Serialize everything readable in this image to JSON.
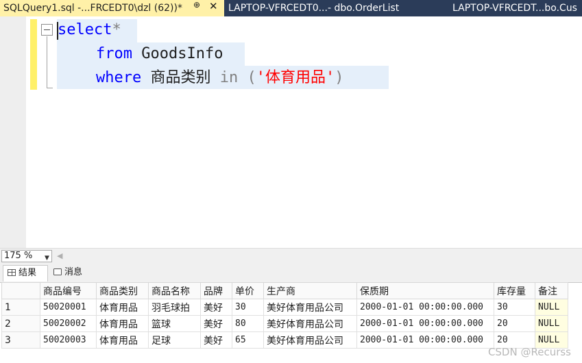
{
  "tabs": [
    {
      "label": "SQLQuery1.sql -...FRCEDT0\\dzl (62))*",
      "pin": "⊕",
      "close": "✕"
    },
    {
      "label": "LAPTOP-VFRCEDT0...- dbo.OrderList"
    },
    {
      "label": "LAPTOP-VFRCEDT...bo.Cus"
    }
  ],
  "editor": {
    "line1": {
      "kw": "select",
      "rest": "*"
    },
    "line2": {
      "kw": "from",
      "rest": " GoodsInfo"
    },
    "line3": {
      "kw": "where",
      "col": " 商品类别 ",
      "op": "in",
      "open": " (",
      "str": "'体育用品'",
      "close": ")"
    }
  },
  "zoom": {
    "value": "175 %"
  },
  "results_tabs": [
    {
      "label": "结果"
    },
    {
      "label": "消息"
    }
  ],
  "results": {
    "columns": [
      "商品编号",
      "商品类别",
      "商品名称",
      "品牌",
      "单价",
      "生产商",
      "保质期",
      "库存量",
      "备注"
    ],
    "rows": [
      {
        "n": "1",
        "cells": [
          "50020001",
          "体育用品",
          "羽毛球拍",
          "美好",
          "30",
          "美好体育用品公司",
          "2000-01-01 00:00:00.000",
          "30",
          "NULL"
        ]
      },
      {
        "n": "2",
        "cells": [
          "50020002",
          "体育用品",
          "篮球",
          "美好",
          "80",
          "美好体育用品公司",
          "2000-01-01 00:00:00.000",
          "20",
          "NULL"
        ]
      },
      {
        "n": "3",
        "cells": [
          "50020003",
          "体育用品",
          "足球",
          "美好",
          "65",
          "美好体育用品公司",
          "2000-01-01 00:00:00.000",
          "20",
          "NULL"
        ]
      }
    ]
  },
  "watermark": "CSDN @Recurss",
  "colors": {
    "keyword": "#0000ff",
    "string": "#ff0000",
    "operator": "#808080",
    "active_tab": "#fff1a8",
    "tab_strip": "#2b3c59",
    "null_cell": "#fffee1"
  }
}
